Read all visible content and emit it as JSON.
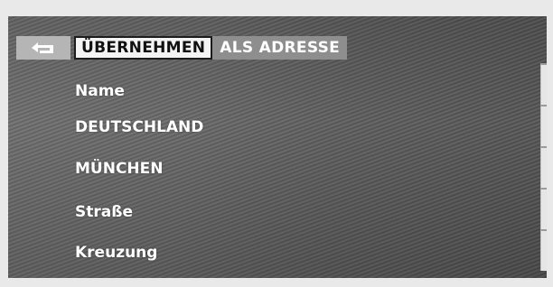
{
  "header": {
    "back_icon": "return-arrow-icon",
    "apply_label": "ÜBERNEHMEN",
    "title_rest": "ALS ADRESSE"
  },
  "menu": {
    "items": [
      {
        "label": "Name"
      },
      {
        "label": "DEUTSCHLAND"
      },
      {
        "label": "MÜNCHEN"
      },
      {
        "label": "Straße"
      },
      {
        "label": "Kreuzung"
      }
    ]
  },
  "colors": {
    "background": "#686868",
    "selected_background": "#f4f4f4",
    "title_background": "#8e8e8e",
    "text": "#ffffff"
  }
}
